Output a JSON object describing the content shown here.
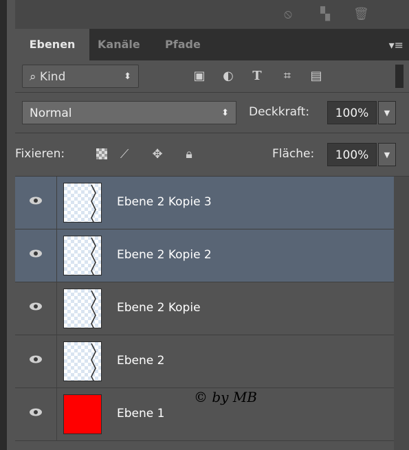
{
  "toolbar_top": {
    "icons": [
      "no-entry-icon",
      "layer-new-icon",
      "trash-icon"
    ]
  },
  "tabs": [
    {
      "label": "Ebenen",
      "active": true
    },
    {
      "label": "Kanäle",
      "active": false
    },
    {
      "label": "Pfade",
      "active": false
    }
  ],
  "filter": {
    "kind_label": "⌕ Kind",
    "icons": [
      "image-filter-icon",
      "adjustment-filter-icon",
      "text-filter-icon",
      "shape-filter-icon",
      "smartobject-filter-icon"
    ]
  },
  "blend": {
    "mode": "Normal",
    "opacity_label": "Deckkraft:",
    "opacity_value": "100%"
  },
  "lock": {
    "label": "Fixieren:",
    "fill_label": "Fläche:",
    "fill_value": "100%"
  },
  "layers": [
    {
      "name": "Ebene 2 Kopie 3",
      "selected": true,
      "thumb": "transparent"
    },
    {
      "name": "Ebene 2 Kopie 2",
      "selected": true,
      "thumb": "transparent"
    },
    {
      "name": "Ebene 2 Kopie",
      "selected": false,
      "thumb": "transparent"
    },
    {
      "name": "Ebene 2",
      "selected": false,
      "thumb": "transparent"
    },
    {
      "name": "Ebene 1",
      "selected": false,
      "thumb": "red"
    }
  ],
  "watermark": "© by MB",
  "colors": {
    "panel_bg": "#535353",
    "selected_row": "#596575",
    "red_fill": "#ff0000"
  }
}
